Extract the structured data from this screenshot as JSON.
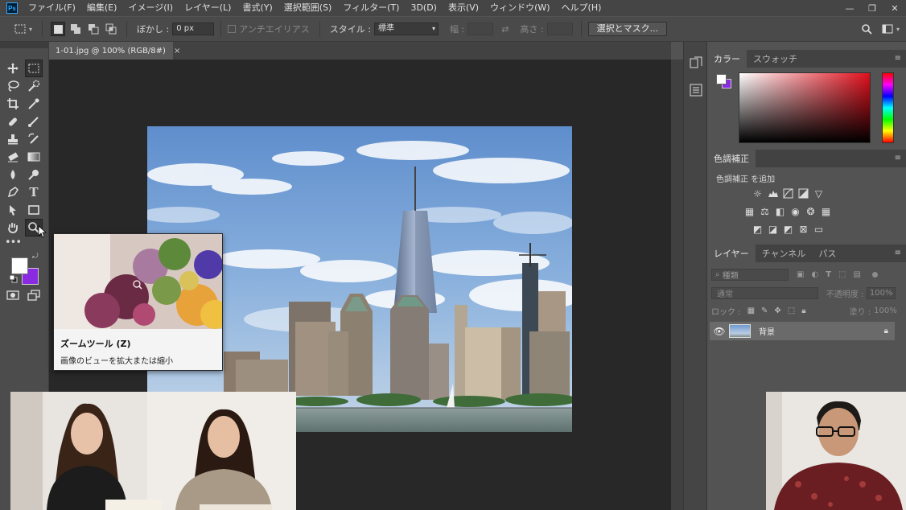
{
  "app": {
    "logo": "Ps"
  },
  "menu": [
    "ファイル(F)",
    "編集(E)",
    "イメージ(I)",
    "レイヤー(L)",
    "書式(Y)",
    "選択範囲(S)",
    "フィルター(T)",
    "3D(D)",
    "表示(V)",
    "ウィンドウ(W)",
    "ヘルプ(H)"
  ],
  "window_controls": {
    "minimize": "—",
    "restore": "❐",
    "close": "✕"
  },
  "options_bar": {
    "feather_label": "ぼかし :",
    "feather_value": "0 px",
    "antialias_label": "アンチエイリアス",
    "style_label": "スタイル :",
    "style_value": "標準",
    "width_label": "幅 :",
    "height_label": "高さ :",
    "select_mask_button": "選択とマスク..."
  },
  "document_tab": {
    "title": "1-01.jpg @ 100% (RGB/8#)",
    "close": "×"
  },
  "tooltip": {
    "title": "ズームツール (Z)",
    "description": "画像のビューを拡大または縮小"
  },
  "panels": {
    "color": {
      "tabs": [
        "カラー",
        "スウォッチ"
      ]
    },
    "adjustments": {
      "tab": "色調補正",
      "add_label": "色調補正 を追加"
    },
    "layers": {
      "tabs": [
        "レイヤー",
        "チャンネル",
        "パス"
      ],
      "filter_label": "種類",
      "blend_mode": "通常",
      "opacity_label": "不透明度 :",
      "opacity_value": "100%",
      "lock_label": "ロック :",
      "fill_label": "塗り :",
      "fill_value": "100%",
      "layer_name": "背景"
    }
  },
  "colors": {
    "foreground": "#ffffff",
    "background": "#8a2be2",
    "accent_blue": "#31a8ff"
  },
  "icons": [
    "move-icon",
    "marquee-icon",
    "lasso-icon",
    "quick-select-icon",
    "crop-icon",
    "eyedropper-icon",
    "healing-icon",
    "brush-icon",
    "stamp-icon",
    "history-brush-icon",
    "eraser-icon",
    "gradient-icon",
    "blur-icon",
    "dodge-icon",
    "pen-icon",
    "type-icon",
    "path-select-icon",
    "shape-icon",
    "hand-icon",
    "zoom-icon",
    "more-icon",
    "search-icon",
    "workspace-icon",
    "eye-icon",
    "lock-icon"
  ]
}
